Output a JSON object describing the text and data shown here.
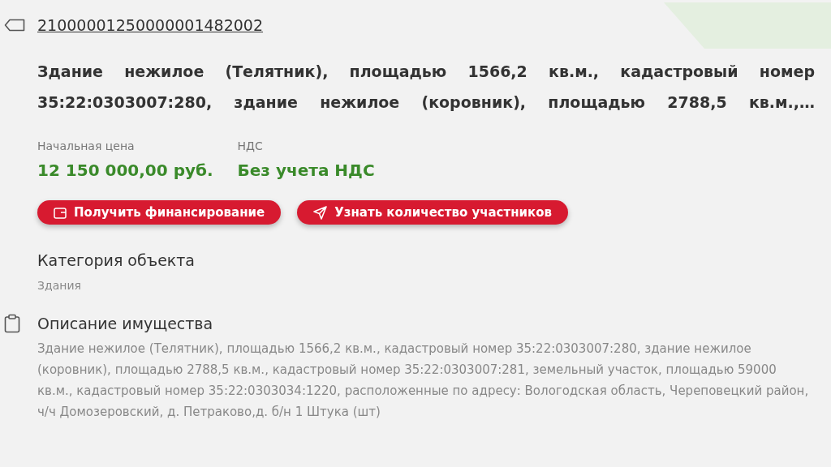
{
  "lot_number": "21000001250000001482002",
  "title_lines": [
    "Здание нежилое (Телятник), площадью 1566,2 кв.м., кадастровый номер",
    "35:22:0303007:280, здание нежилое (коровник), площадью 2788,5 кв.м.,…"
  ],
  "price": {
    "label": "Начальная цена",
    "value": "12 150 000,00 руб."
  },
  "vat": {
    "label": "НДС",
    "value": "Без учета НДС"
  },
  "buttons": [
    {
      "kind": "wallet",
      "label": "Получить финансирование"
    },
    {
      "kind": "send",
      "label": "Узнать количество участников"
    }
  ],
  "category": {
    "label": "Категория объекта",
    "value": "Здания"
  },
  "description": {
    "label": "Описание имущества",
    "value": "Здание нежилое (Телятник), площадью 1566,2 кв.м., кадастровый номер 35:22:0303007:280, здание нежилое (коровник), площадью 2788,5 кв.м., кадастровый номер 35:22:0303007:281, земельный участок, площадью 59000 кв.м., кадастровый номер 35:22:0303034:1220, расположенные по адресу: Вологодская область, Череповецкий район, ч/ч Домозеровский, д. Петраково,д. б/н 1 Штука (шт)"
  }
}
